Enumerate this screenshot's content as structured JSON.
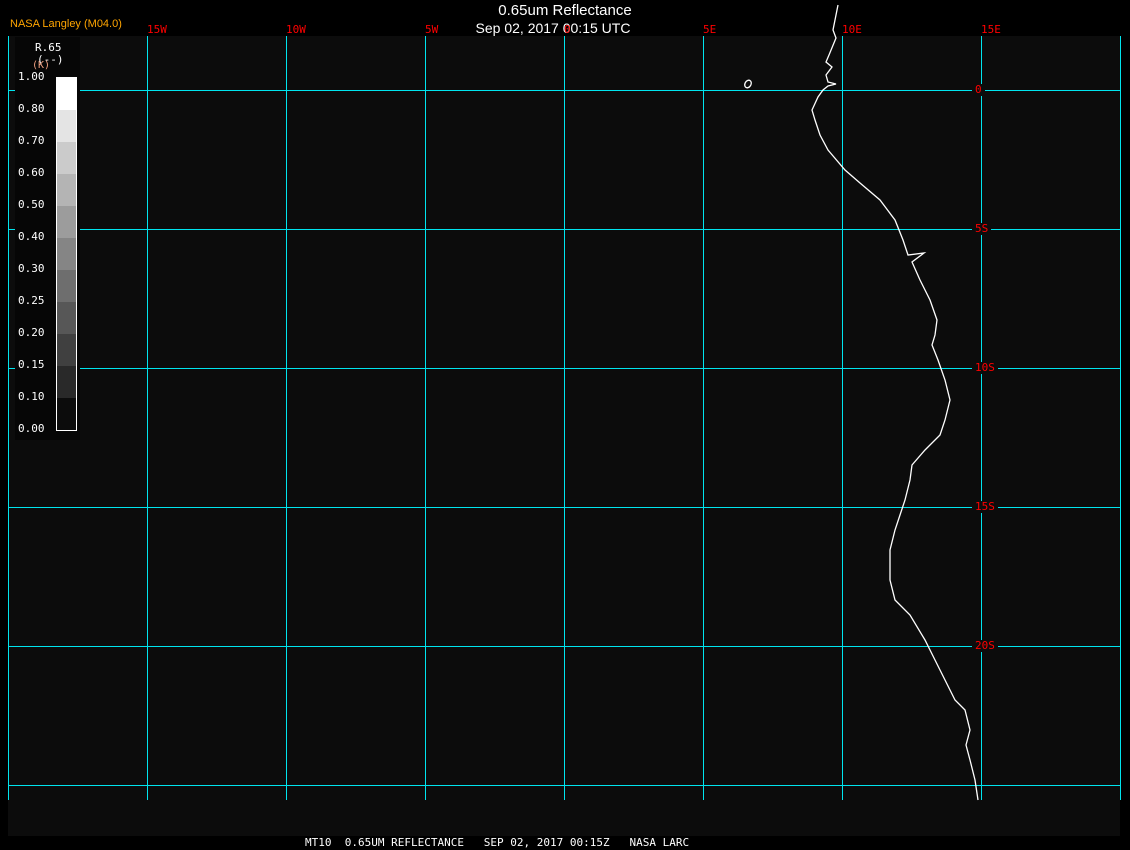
{
  "header": {
    "source": "NASA Langley (M04.0)",
    "title": "0.65um Reflectance",
    "datetime": "Sep 02, 2017 00:15 UTC"
  },
  "grid": {
    "lon_labels": [
      "15W",
      "10W",
      "5W",
      "0",
      "5E",
      "10E",
      "15E"
    ],
    "lat_labels": [
      "0",
      "5S",
      "10S",
      "15S",
      "20S"
    ],
    "line_color": "#00e5ee",
    "label_color": "#ff0000",
    "coast_color": "#ffffff"
  },
  "legend": {
    "name": "R.65",
    "units": "(--)",
    "unit_overlay": "(K)",
    "values": [
      "1.00",
      "0.80",
      "0.70",
      "0.60",
      "0.50",
      "0.40",
      "0.30",
      "0.25",
      "0.20",
      "0.15",
      "0.10",
      "0.00"
    ],
    "colors": [
      "#ffffff",
      "#e4e4e4",
      "#cbcbcb",
      "#b4b4b4",
      "#9c9c9c",
      "#858585",
      "#6e6e6e",
      "#575757",
      "#404040",
      "#292929",
      "#0c0c0c"
    ]
  },
  "footer": {
    "text": "MT10  0.65UM REFLECTANCE   SEP 02, 2017 00:15Z   NASA LARC"
  }
}
